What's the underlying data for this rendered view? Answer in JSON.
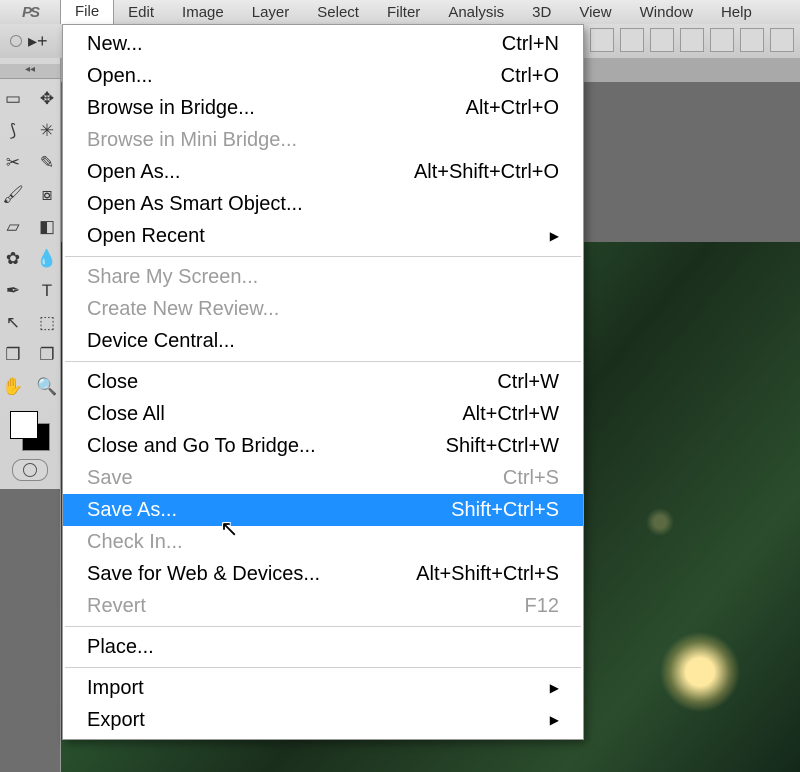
{
  "menubar": {
    "items": [
      "File",
      "Edit",
      "Image",
      "Layer",
      "Select",
      "Filter",
      "Analysis",
      "3D",
      "View",
      "Window",
      "Help"
    ],
    "active_index": 0
  },
  "file_menu": {
    "groups": [
      [
        {
          "label": "New...",
          "shortcut": "Ctrl+N",
          "enabled": true
        },
        {
          "label": "Open...",
          "shortcut": "Ctrl+O",
          "enabled": true
        },
        {
          "label": "Browse in Bridge...",
          "shortcut": "Alt+Ctrl+O",
          "enabled": true
        },
        {
          "label": "Browse in Mini Bridge...",
          "shortcut": "",
          "enabled": false
        },
        {
          "label": "Open As...",
          "shortcut": "Alt+Shift+Ctrl+O",
          "enabled": true
        },
        {
          "label": "Open As Smart Object...",
          "shortcut": "",
          "enabled": true
        },
        {
          "label": "Open Recent",
          "shortcut": "",
          "enabled": true,
          "submenu": true
        }
      ],
      [
        {
          "label": "Share My Screen...",
          "shortcut": "",
          "enabled": false
        },
        {
          "label": "Create New Review...",
          "shortcut": "",
          "enabled": false
        },
        {
          "label": "Device Central...",
          "shortcut": "",
          "enabled": true
        }
      ],
      [
        {
          "label": "Close",
          "shortcut": "Ctrl+W",
          "enabled": true
        },
        {
          "label": "Close All",
          "shortcut": "Alt+Ctrl+W",
          "enabled": true
        },
        {
          "label": "Close and Go To Bridge...",
          "shortcut": "Shift+Ctrl+W",
          "enabled": true
        },
        {
          "label": "Save",
          "shortcut": "Ctrl+S",
          "enabled": false
        },
        {
          "label": "Save As...",
          "shortcut": "Shift+Ctrl+S",
          "enabled": true,
          "highlight": true
        },
        {
          "label": "Check In...",
          "shortcut": "",
          "enabled": false
        },
        {
          "label": "Save for Web & Devices...",
          "shortcut": "Alt+Shift+Ctrl+S",
          "enabled": true
        },
        {
          "label": "Revert",
          "shortcut": "F12",
          "enabled": false
        }
      ],
      [
        {
          "label": "Place...",
          "shortcut": "",
          "enabled": true
        }
      ],
      [
        {
          "label": "Import",
          "shortcut": "",
          "enabled": true,
          "submenu": true
        },
        {
          "label": "Export",
          "shortcut": "",
          "enabled": true,
          "submenu": true
        }
      ]
    ]
  },
  "tools": {
    "rows": [
      [
        "marquee",
        "move-alt"
      ],
      [
        "lasso",
        "quick-select"
      ],
      [
        "crop",
        "eyedropper"
      ],
      [
        "brush",
        "stamp"
      ],
      [
        "eraser",
        "gradient"
      ],
      [
        "drop",
        "pen"
      ],
      [
        "pen2",
        "type"
      ],
      [
        "arrow",
        "path"
      ],
      [
        "3d",
        "3d-cam"
      ],
      [
        "hand",
        "zoom"
      ]
    ],
    "glyphs": {
      "marquee": "▭",
      "move-alt": "✥",
      "lasso": "⟆",
      "quick-select": "✳",
      "crop": "✂",
      "eyedropper": "✎",
      "brush": "🖌",
      "stamp": "⧇",
      "eraser": "▱",
      "gradient": "◧",
      "drop": "✿",
      "pen": "💧",
      "pen2": "✒",
      "type": "T",
      "arrow": "↖",
      "path": "⬚",
      "3d": "❒",
      "3d-cam": "❐",
      "hand": "✋",
      "zoom": "🔍"
    }
  },
  "logo": "PS"
}
